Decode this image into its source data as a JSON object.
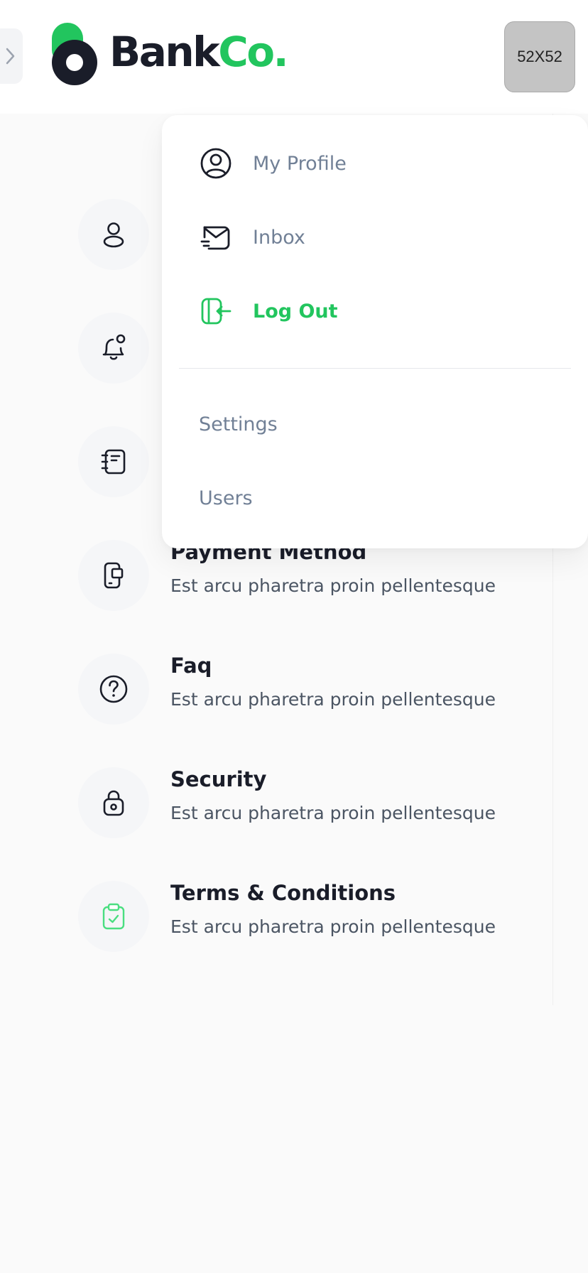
{
  "header": {
    "logo": {
      "part1": "Bank",
      "part2": "Co."
    },
    "avatar_text": "52X52"
  },
  "colors": {
    "brand": "#22c55e",
    "dark": "#1a1d29",
    "muted": "#718096"
  },
  "dropdown": {
    "items": [
      {
        "label": "My Profile",
        "icon": "user-circle-icon"
      },
      {
        "label": "Inbox",
        "icon": "inbox-icon"
      },
      {
        "label": "Log Out",
        "icon": "logout-icon"
      }
    ],
    "links": [
      {
        "label": "Settings"
      },
      {
        "label": "Users"
      }
    ]
  },
  "settings": {
    "items": [
      {
        "title": "",
        "desc": "",
        "icon": "user-icon"
      },
      {
        "title": "",
        "desc": "",
        "icon": "bell-icon"
      },
      {
        "title": "",
        "desc": "",
        "icon": "notebook-icon"
      },
      {
        "title": "Payment Method",
        "desc": "Est arcu pharetra proin pellentesque",
        "icon": "device-icon"
      },
      {
        "title": "Faq",
        "desc": "Est arcu pharetra proin pellentesque",
        "icon": "question-icon"
      },
      {
        "title": "Security",
        "desc": "Est arcu pharetra proin pellentesque",
        "icon": "lock-icon"
      },
      {
        "title": "Terms & Conditions",
        "desc": "Est arcu pharetra proin pellentesque",
        "icon": "clipboard-check-icon"
      }
    ]
  }
}
